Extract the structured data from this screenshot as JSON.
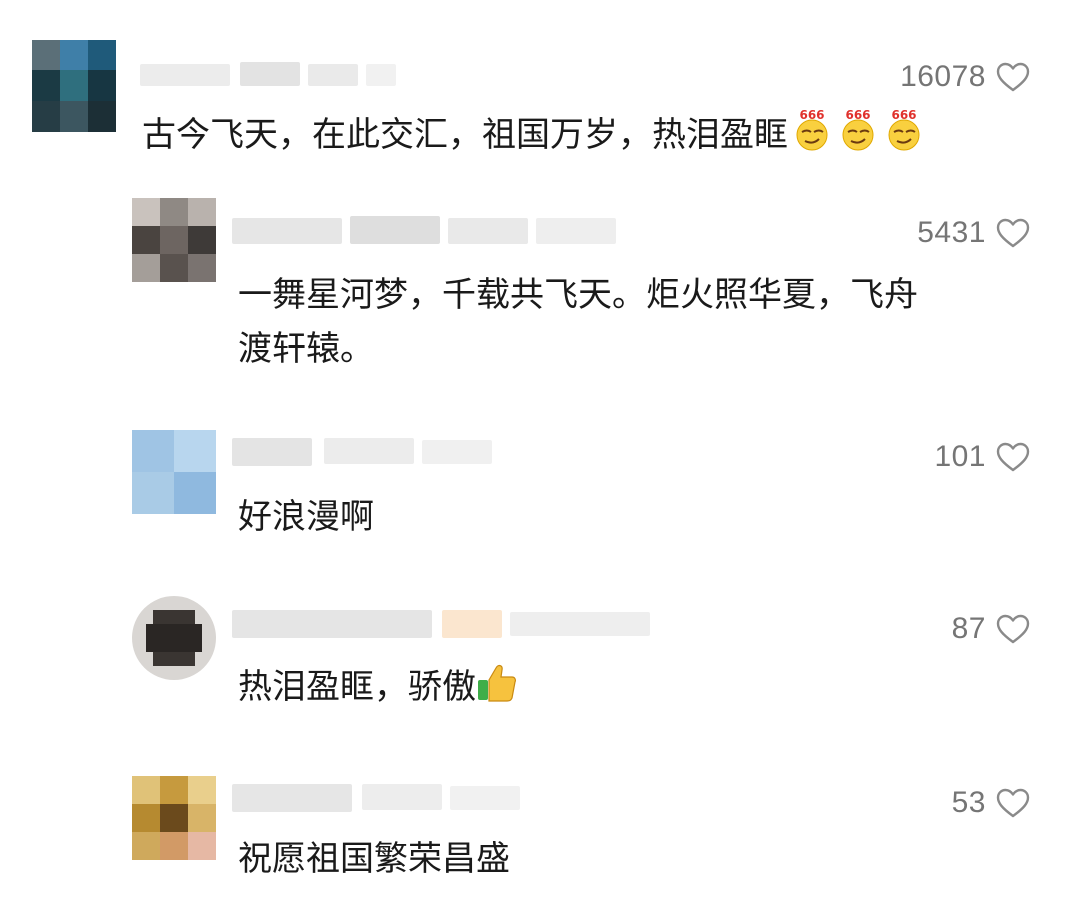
{
  "comments": [
    {
      "likes": "16078",
      "text": "古今飞天，在此交汇，祖国万岁，热泪盈眶",
      "stickers": [
        "666",
        "666",
        "666"
      ]
    },
    {
      "likes": "5431",
      "text_line1": "一舞星河梦，千载共飞天。炬火照华夏，飞舟",
      "text_line2": "渡轩辕。"
    },
    {
      "likes": "101",
      "text": "好浪漫啊"
    },
    {
      "likes": "87",
      "text": "热泪盈眶，骄傲",
      "emoji": "thumbs-up-icon"
    },
    {
      "likes": "53",
      "text": "祝愿祖国繁荣昌盛"
    }
  ],
  "colors": {
    "like_count": "#757575",
    "text": "#1a1a1a",
    "heart": "#8a8a8a"
  }
}
